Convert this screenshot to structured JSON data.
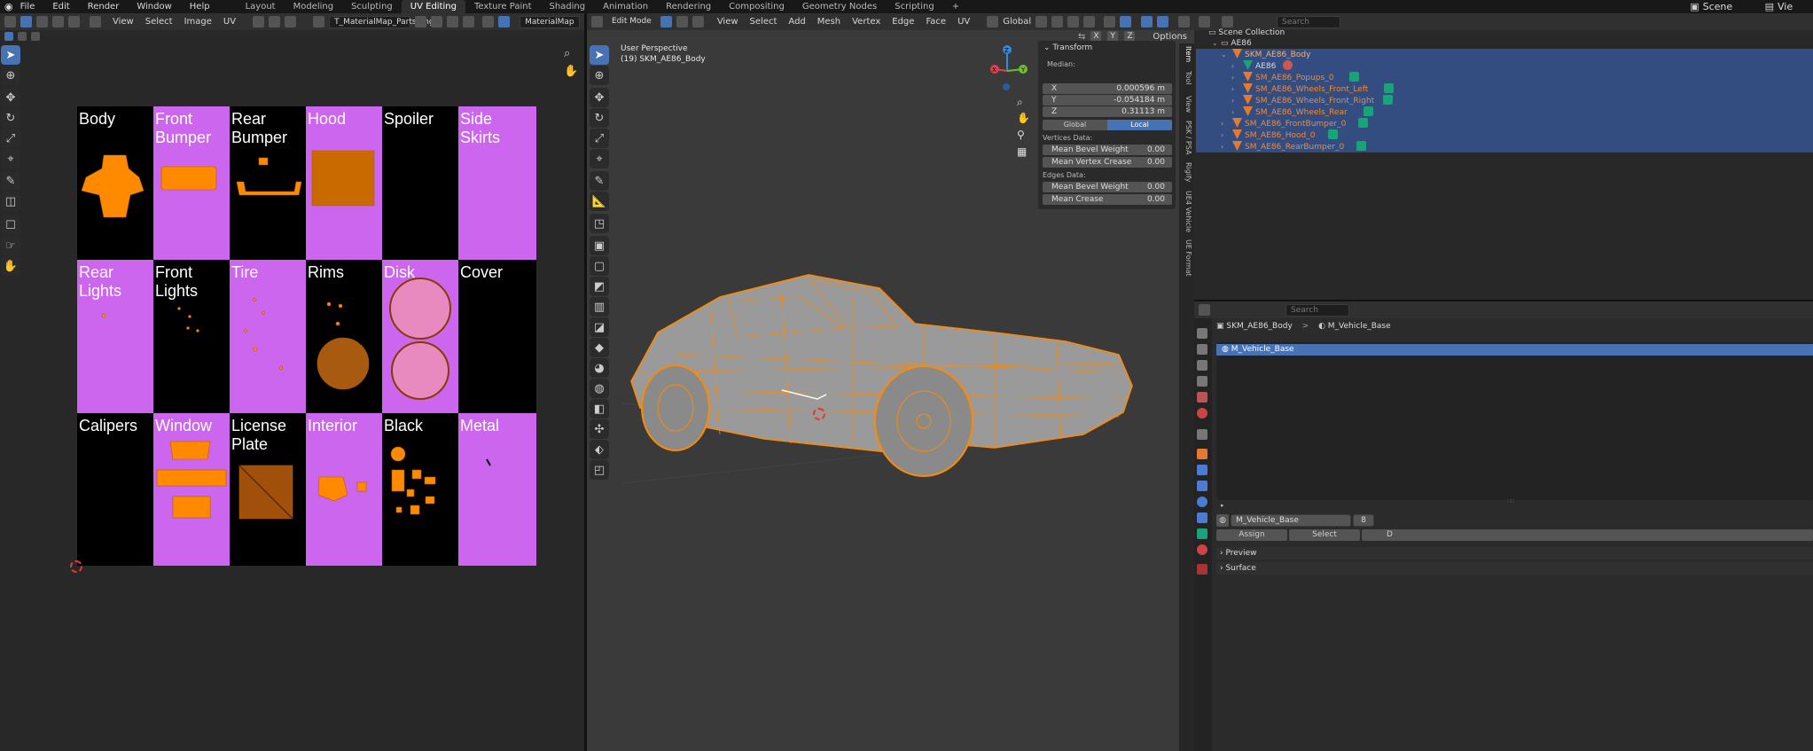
{
  "menubar": {
    "items": [
      "File",
      "Edit",
      "Render",
      "Window",
      "Help"
    ],
    "workspaces": [
      "Layout",
      "Modeling",
      "Sculpting",
      "UV Editing",
      "Texture Paint",
      "Shading",
      "Animation",
      "Rendering",
      "Compositing",
      "Geometry Nodes",
      "Scripting"
    ],
    "active_workspace": "UV Editing",
    "add": "+",
    "scene": "Scene",
    "view_layer": "Vie"
  },
  "uv_editor": {
    "menus": [
      "View",
      "Select",
      "Image",
      "UV"
    ],
    "image_name": "T_MaterialMap_Parts.png",
    "uv_map": "MaterialMap",
    "cells": [
      {
        "label": "Body",
        "color": "black"
      },
      {
        "label": "Front Bumper",
        "color": "purple"
      },
      {
        "label": "Rear Bumper",
        "color": "black"
      },
      {
        "label": "Hood",
        "color": "purple"
      },
      {
        "label": "Spoiler",
        "color": "black"
      },
      {
        "label": "Side Skirts",
        "color": "purple"
      },
      {
        "label": "Rear Lights",
        "color": "purple"
      },
      {
        "label": "Front Lights",
        "color": "black"
      },
      {
        "label": "Tire",
        "color": "purple"
      },
      {
        "label": "Rims",
        "color": "black"
      },
      {
        "label": "Disk",
        "color": "purple"
      },
      {
        "label": "Cover",
        "color": "black"
      },
      {
        "label": "Calipers",
        "color": "black"
      },
      {
        "label": "Window",
        "color": "purple"
      },
      {
        "label": "License Plate",
        "color": "black"
      },
      {
        "label": "Interior",
        "color": "purple"
      },
      {
        "label": "Black",
        "color": "black"
      },
      {
        "label": "Metal",
        "color": "purple"
      }
    ]
  },
  "viewport": {
    "mode": "Edit Mode",
    "menus": [
      "View",
      "Select",
      "Add",
      "Mesh",
      "Vertex",
      "Edge",
      "Face",
      "UV"
    ],
    "orientation": "Global",
    "overlay_title": "User Perspective",
    "overlay_object": "(19) SKM_AE86_Body",
    "axes_toggle": [
      "X",
      "Y",
      "Z"
    ],
    "options": "Options",
    "gizmo": {
      "x": "X",
      "y": "Y",
      "z": "Z"
    }
  },
  "n_panel": {
    "title": "Transform",
    "median_label": "Median:",
    "x": {
      "label": "X",
      "value": "0.000596 m"
    },
    "y": {
      "label": "Y",
      "value": "-0.054184 m"
    },
    "z": {
      "label": "Z",
      "value": "0.31113 m"
    },
    "global_label": "Global",
    "local_label": "Local",
    "vertices_header": "Vertices Data:",
    "mean_bevel_weight_v": {
      "label": "Mean Bevel Weight",
      "value": "0.00"
    },
    "mean_vertex_crease": {
      "label": "Mean Vertex Crease",
      "value": "0.00"
    },
    "edges_header": "Edges Data:",
    "mean_bevel_weight_e": {
      "label": "Mean Bevel Weight",
      "value": "0.00"
    },
    "mean_crease": {
      "label": "Mean Crease",
      "value": "0.00"
    },
    "tabs": [
      "Item",
      "Tool",
      "View",
      "PSK / PSA",
      "Rigify",
      "UE4 Vehicle",
      "UE Format"
    ]
  },
  "outliner": {
    "search_placeholder": "Search",
    "scene_collection": "Scene Collection",
    "root": "AE86",
    "items": [
      {
        "name": "SKM_AE86_Body",
        "indent": 2,
        "type": "obj",
        "selected": true
      },
      {
        "name": "AE86",
        "indent": 3,
        "type": "mesh",
        "selected": false
      },
      {
        "name": "SM_AE86_Popups_0",
        "indent": 3,
        "type": "obj",
        "selected": true
      },
      {
        "name": "SM_AE86_Wheels_Front_Left",
        "indent": 3,
        "type": "obj",
        "selected": true
      },
      {
        "name": "SM_AE86_Wheels_Front_Right",
        "indent": 3,
        "type": "obj",
        "selected": true
      },
      {
        "name": "SM_AE86_Wheels_Rear",
        "indent": 3,
        "type": "obj",
        "selected": true
      },
      {
        "name": "SM_AE86_FrontBumper_0",
        "indent": 2,
        "type": "obj",
        "selected": true
      },
      {
        "name": "SM_AE86_Hood_0",
        "indent": 2,
        "type": "obj",
        "selected": true
      },
      {
        "name": "SM_AE86_RearBumper_0",
        "indent": 2,
        "type": "obj",
        "selected": true
      }
    ]
  },
  "properties": {
    "search_placeholder": "Search",
    "breadcrumb_object": "SKM_AE86_Body",
    "breadcrumb_sep": ">",
    "breadcrumb_material": "M_Vehicle_Base",
    "slots": [
      "M_Vehicle_Base"
    ],
    "material_name": "M_Vehicle_Base",
    "user_count": "8",
    "assign": "Assign",
    "select": "Select",
    "deselect_partial": "D",
    "preview": "Preview",
    "surface": "Surface"
  },
  "colors": {
    "accent": "#4772b3",
    "selection_orange": "#ff8a00",
    "purple_cell": "#cc66ee"
  }
}
